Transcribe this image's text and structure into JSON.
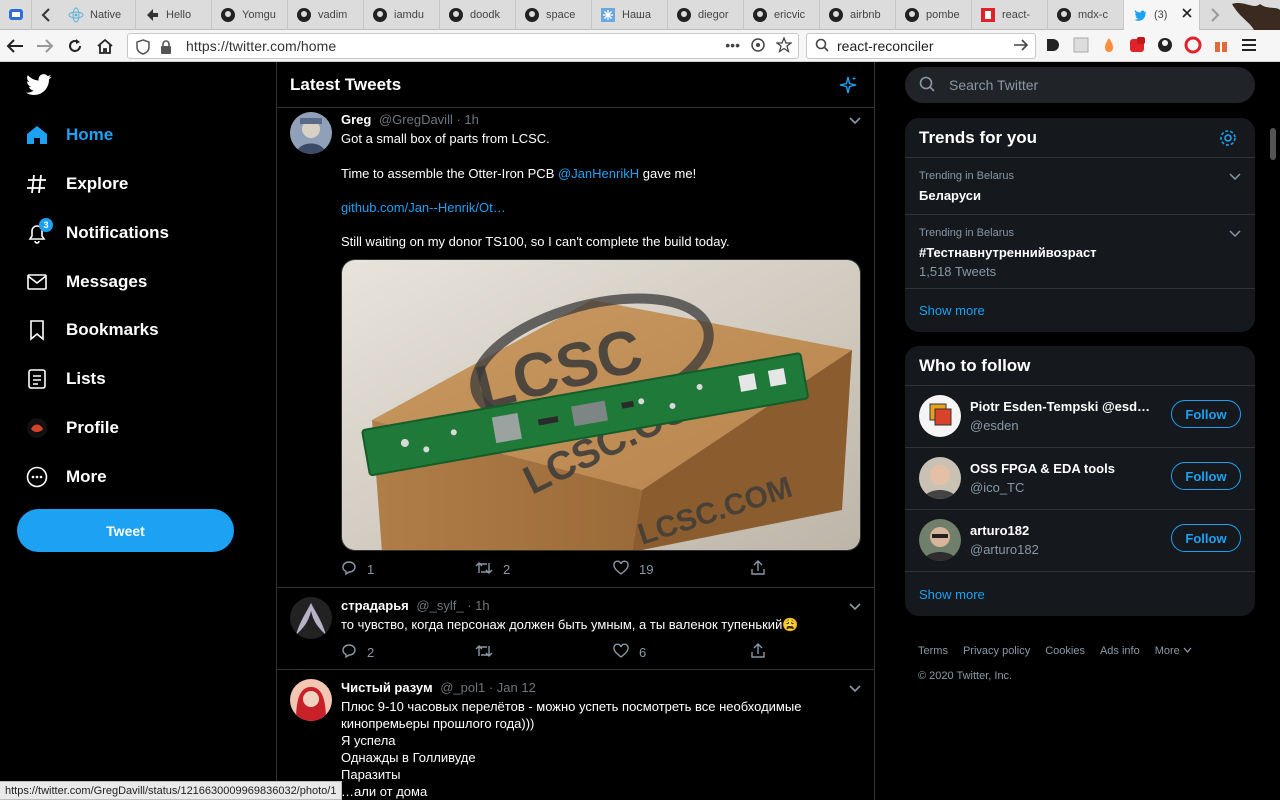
{
  "browser": {
    "tabs": [
      {
        "title": "",
        "icon": "chat-icon"
      },
      {
        "title": "",
        "icon": "chevron-left-icon"
      },
      {
        "title": "Native",
        "icon": "react-icon"
      },
      {
        "title": "Hello",
        "icon": "hello-icon"
      },
      {
        "title": "Yomgu",
        "icon": "github-icon"
      },
      {
        "title": "vadim",
        "icon": "github-icon"
      },
      {
        "title": "iamdu",
        "icon": "github-icon"
      },
      {
        "title": "doodk",
        "icon": "github-icon"
      },
      {
        "title": "space",
        "icon": "github-icon"
      },
      {
        "title": "Наша",
        "icon": "snowflake-icon"
      },
      {
        "title": "diegor",
        "icon": "github-icon"
      },
      {
        "title": "ericvic",
        "icon": "github-icon"
      },
      {
        "title": "airbnb",
        "icon": "github-icon"
      },
      {
        "title": "pombe",
        "icon": "github-icon"
      },
      {
        "title": "react-",
        "icon": "react-icon"
      },
      {
        "title": "mdx-c",
        "icon": "github-icon"
      },
      {
        "title": "(3)",
        "icon": "twitter-icon"
      }
    ],
    "url": "https://twitter.com/home",
    "search_value": "react-reconciler",
    "status_url": "https://twitter.com/GregDavill/status/1216630009969836032/photo/1"
  },
  "nav": {
    "home": "Home",
    "explore": "Explore",
    "notifications": "Notifications",
    "notifications_badge": "3",
    "messages": "Messages",
    "bookmarks": "Bookmarks",
    "lists": "Lists",
    "profile": "Profile",
    "more": "More",
    "tweet_button": "Tweet"
  },
  "timeline": {
    "title": "Latest Tweets",
    "tweets": [
      {
        "name": "Greg",
        "handle": "@GregDavill",
        "time": "· 1h",
        "lines": [
          "Got a small box of parts from LCSC.",
          "Time to assemble the Otter-Iron PCB",
          "@JanHenrikH",
          "gave me!",
          "github.com/Jan--Henrik/Ot…",
          "Still waiting on my donor TS100, so I can't complete the build today."
        ],
        "image_texts": [
          "LCSC",
          "LCSC.COM",
          "LCSC.COM"
        ],
        "replies": "1",
        "retweets": "2",
        "likes": "19"
      },
      {
        "name": "страдарья",
        "handle": "@_sylf_",
        "time": "· 1h",
        "lines": [
          "то чувство, когда персонаж должен быть умным, а ты валенок тупенький😩"
        ],
        "replies": "2",
        "retweets": "",
        "likes": "6"
      },
      {
        "name": "Чистый разум",
        "handle": "@_pol1",
        "time": "· Jan 12",
        "lines": [
          "Плюс 9-10 часовых перелётов - можно успеть посмотреть все необходимые",
          "кинопремьеры прошлого года)))",
          "Я успела",
          "Однажды в Голливуде",
          "Паразиты",
          "…али от дома"
        ]
      }
    ]
  },
  "right": {
    "search_placeholder": "Search Twitter",
    "trends_title": "Trends for you",
    "trends": [
      {
        "context": "Trending in Belarus",
        "name": "Беларуси",
        "count": ""
      },
      {
        "context": "Trending in Belarus",
        "name": "#Тестнавнутреннийвозраст",
        "count": "1,518 Tweets"
      }
    ],
    "trends_show_more": "Show more",
    "wtf_title": "Who to follow",
    "who_to_follow": [
      {
        "name": "Piotr Esden-Tempski @esd…",
        "handle": "@esden",
        "button": "Follow"
      },
      {
        "name": "OSS FPGA & EDA tools",
        "handle": "@ico_TC",
        "button": "Follow"
      },
      {
        "name": "arturo182",
        "handle": "@arturo182",
        "button": "Follow"
      }
    ],
    "wtf_show_more": "Show more",
    "footer": {
      "terms": "Terms",
      "privacy": "Privacy policy",
      "cookies": "Cookies",
      "ads": "Ads info",
      "more": "More",
      "copyright": "© 2020 Twitter, Inc."
    }
  },
  "colors": {
    "accent": "#1da1f2",
    "background": "#000000",
    "card": "#15181c",
    "border": "#2f3336",
    "muted": "#8899a6"
  }
}
